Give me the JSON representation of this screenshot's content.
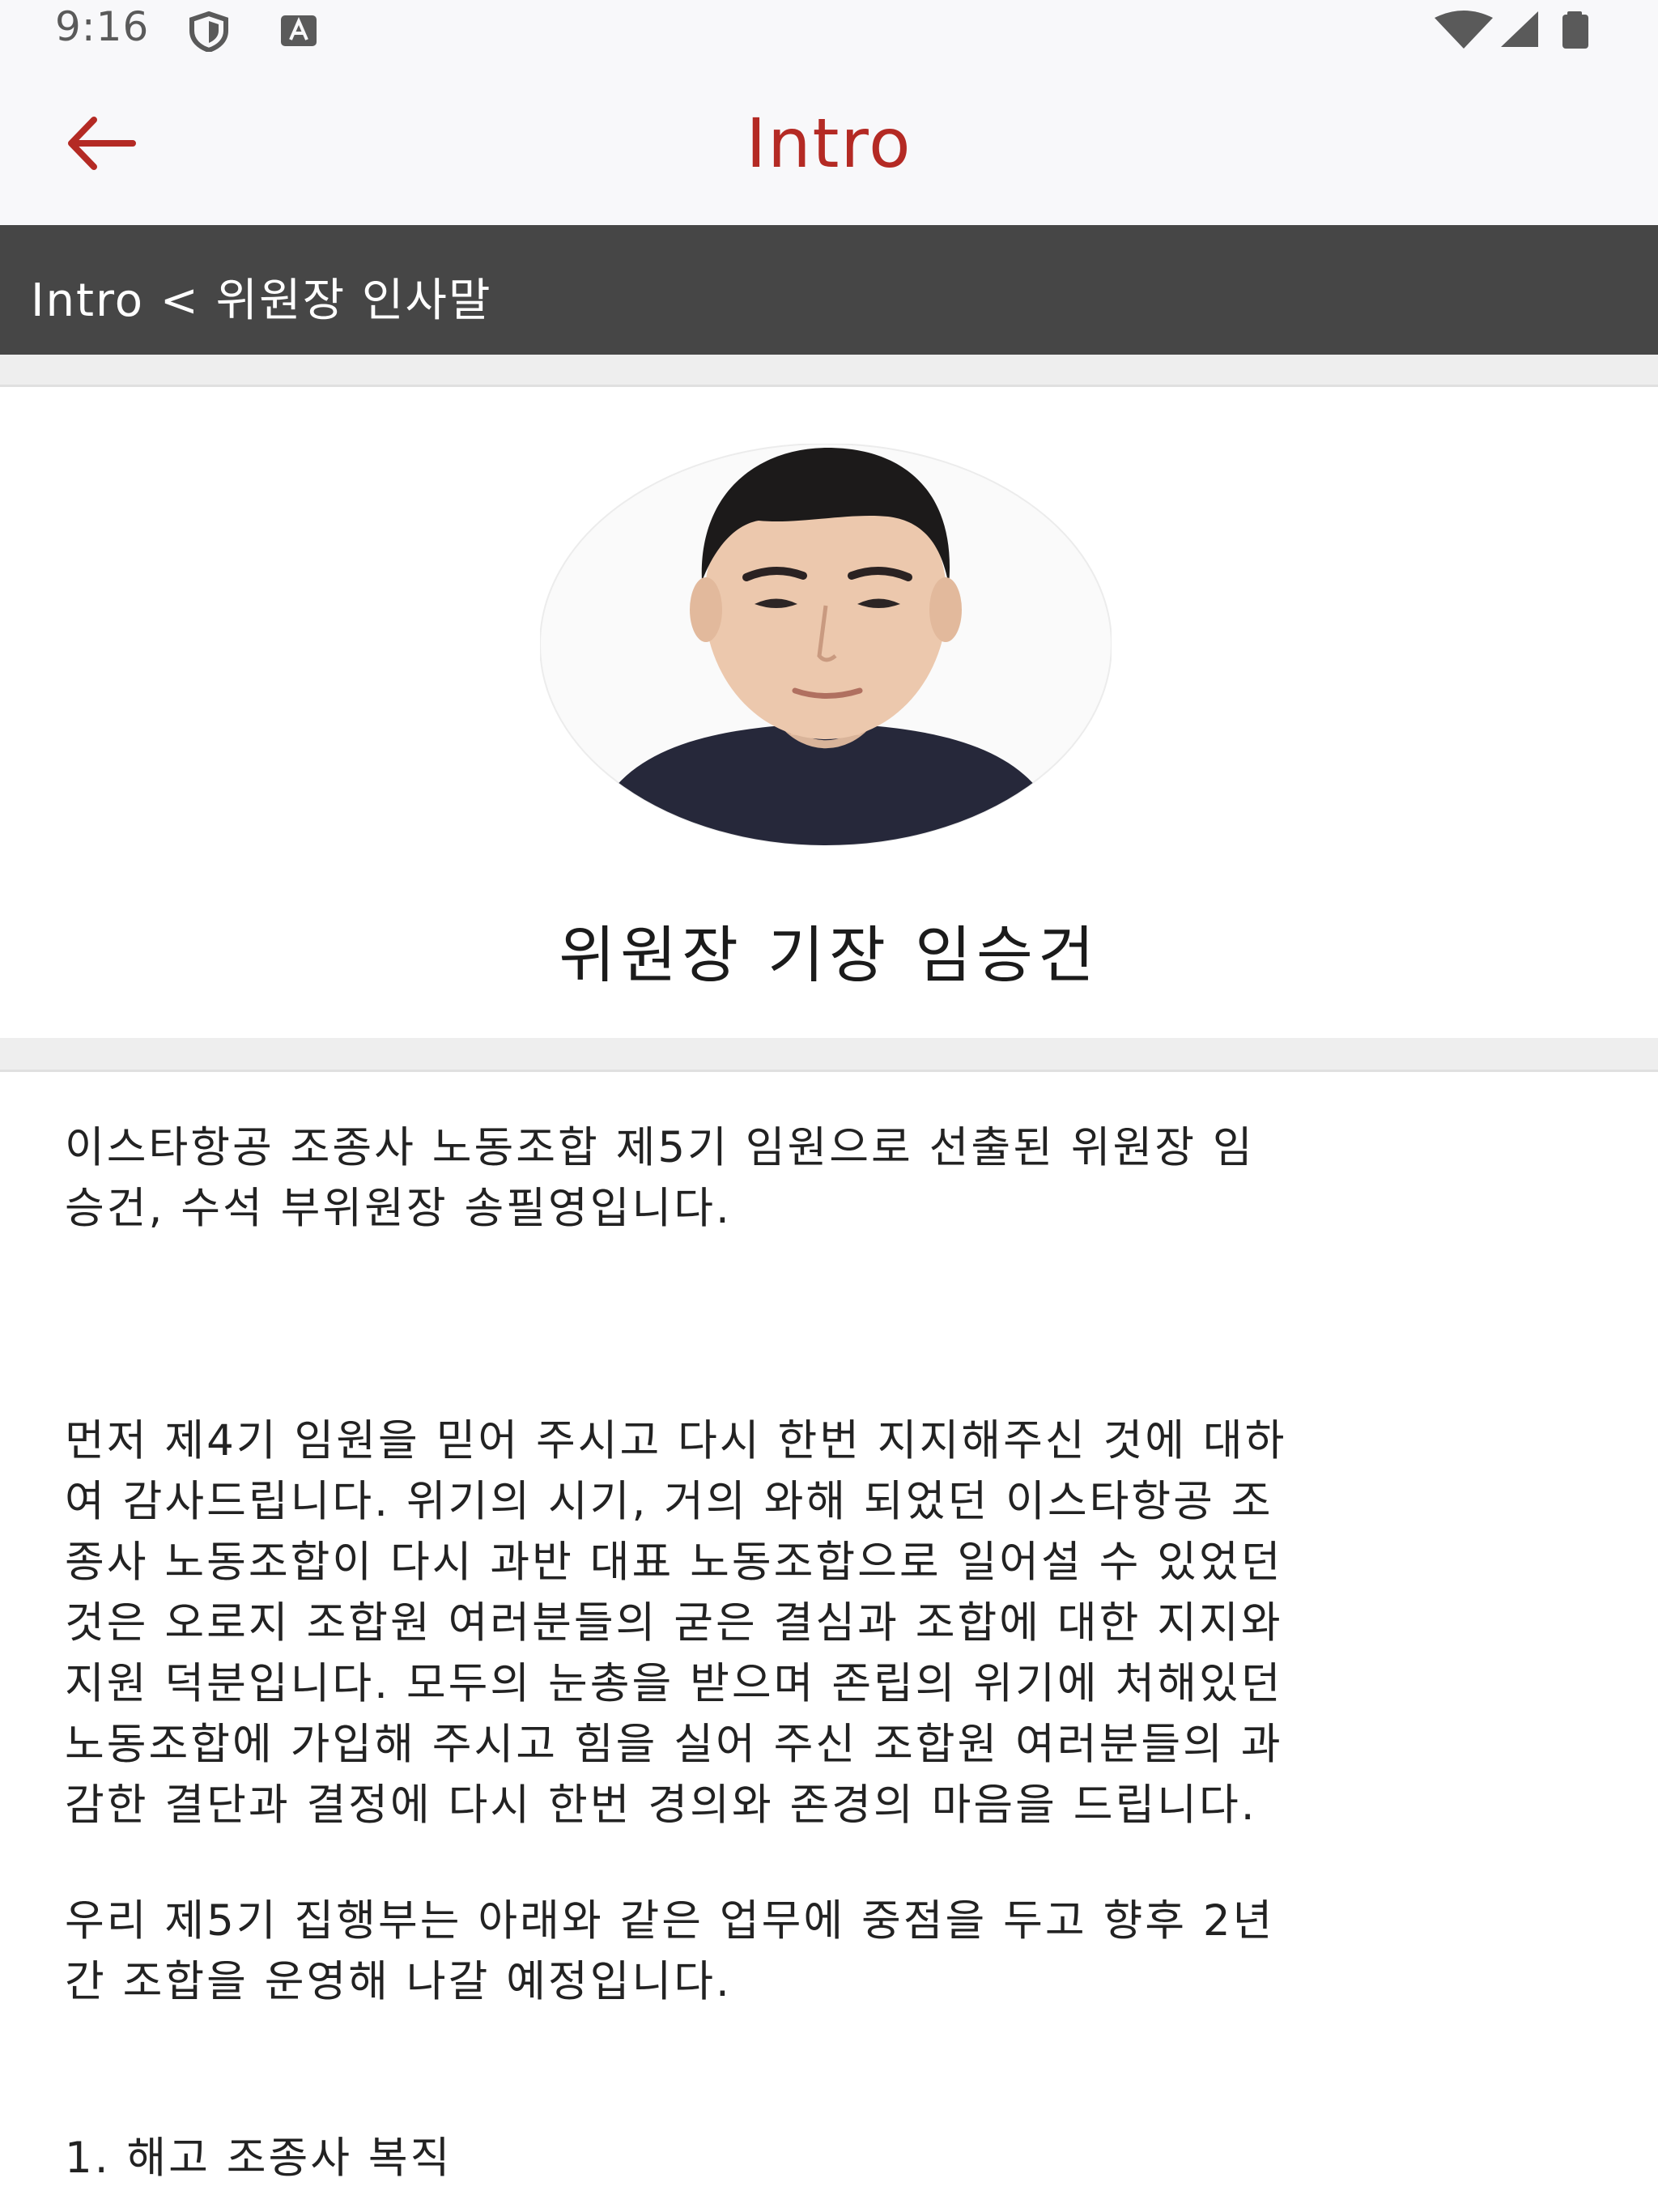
{
  "status_bar": {
    "time": "9:16",
    "icons": [
      "shield-icon",
      "keyboard-a-icon",
      "wifi-icon",
      "signal-icon",
      "battery-icon"
    ]
  },
  "app_bar": {
    "title": "Intro",
    "back_icon": "arrow-left-icon",
    "accent_color": "#b42a24"
  },
  "breadcrumb": {
    "text": "Intro < 위원장 인사말"
  },
  "profile": {
    "name": "위원장 기장 임승건"
  },
  "content": {
    "paragraphs": [
      "이스타항공 조종사 노동조합 제5기 임원으로 선출된 위원장 임\n승건, 수석 부위원장 송필영입니다.",
      "먼저 제4기 임원을 믿어 주시고 다시 한번 지지해주신 것에 대하\n여 감사드립니다. 위기의 시기, 거의 와해 되었던 이스타항공 조\n종사 노동조합이 다시 과반 대표 노동조합으로 일어설 수 있었던\n것은 오로지 조합원 여러분들의 굳은 결심과 조합에 대한 지지와\n지원 덕분입니다. 모두의 눈총을 받으며 존립의 위기에 처해있던\n노동조합에 가입해 주시고 힘을 실어 주신 조합원 여러분들의 과\n감한 결단과 결정에 다시 한번 경의와 존경의 마음을 드립니다.",
      "우리 제5기 집행부는 아래와 같은 업무에 중점을 두고 향후 2년\n간 조합을 운영해 나갈 예정입니다.",
      "1. 해고 조종사 복직"
    ]
  }
}
